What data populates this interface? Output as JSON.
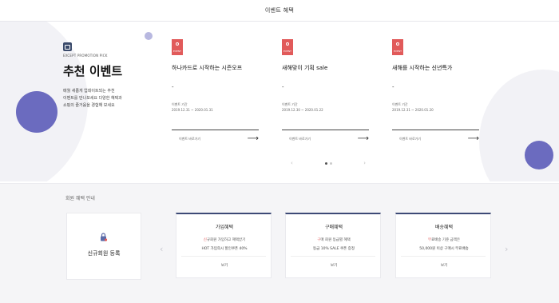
{
  "header": {
    "title": "이벤트 혜택"
  },
  "promo": {
    "tag": "EXCEPT PROMOTION PICK",
    "title": "추천 이벤트",
    "desc_lines": [
      "매월 새롭게 업데이트되는 추천",
      "이벤트를 만나보세요 다양한 혜택과",
      "쇼핑의 즐거움을 경험해 보세요"
    ]
  },
  "events": [
    {
      "badge": "EVENT",
      "name": "하나카드로 시작하는 시즌오프",
      "dash": "-",
      "meta_label": "이벤트 기간",
      "meta_date": "2019.12.31 ~ 2020.01.31",
      "more": "이벤트 바로가기"
    },
    {
      "badge": "EVENT",
      "name": "새해맞이 기획 sale",
      "dash": "-",
      "meta_label": "이벤트 기간",
      "meta_date": "2019.12.30 ~ 2020.01.22",
      "more": "이벤트 바로가기"
    },
    {
      "badge": "EVENT",
      "name": "새해를 시작하는 신년특가",
      "dash": "-",
      "meta_label": "이벤트 기간",
      "meta_date": "2019.12.31 ~ 2020.01.20",
      "more": "이벤트 바로가기"
    }
  ],
  "benefits_section": {
    "heading": "회원 혜택 안내"
  },
  "coupon": {
    "label": "신규회원 등록"
  },
  "benefits": [
    {
      "title": "가입혜택",
      "question_hl": "신",
      "question": "규회원 가입하고 혜택받기",
      "detail": "HOT 가입즉시 할인쿠폰 40%",
      "button": "보기"
    },
    {
      "title": "구매혜택",
      "question_hl": "구",
      "question": "매 회원 등급별 혜택",
      "detail": "등급 10% SALE 쿠폰 증정",
      "button": "보기"
    },
    {
      "title": "배송혜택",
      "question_hl": "무",
      "question": "료배송 기준 금액은",
      "detail": "50,000원 이상 구매시 무료배송",
      "button": "보기"
    }
  ],
  "colors": {
    "accent": "#6b6bbf",
    "badge": "#e15a5a",
    "navy": "#3d4a76"
  },
  "icons": {
    "coupon": "lock-tag-icon",
    "next": "arrow-right-icon",
    "prev": "chevron-left-icon"
  }
}
